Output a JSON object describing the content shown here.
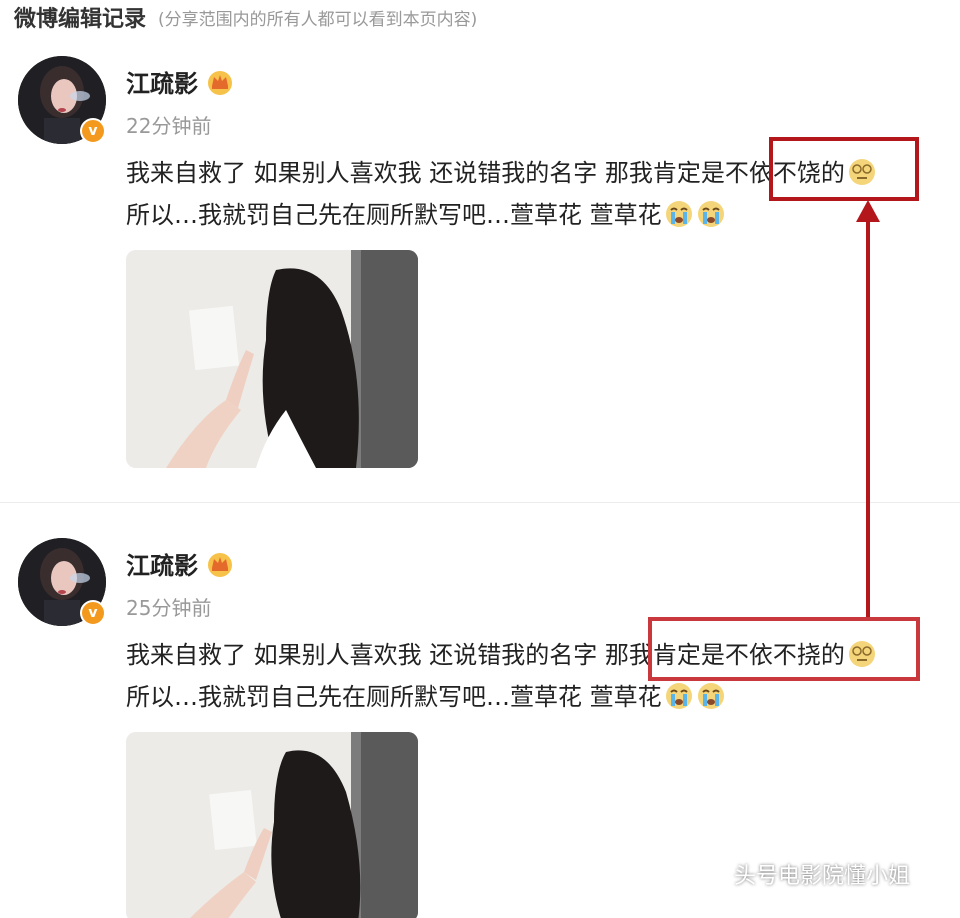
{
  "header": {
    "title": "微博编辑记录",
    "note": "(分享范围内的所有人都可以看到本页内容)"
  },
  "posts": [
    {
      "author": "江疏影",
      "time": "22分钟前",
      "line1": "我来自救了 如果别人喜欢我 还说错我的名字 那我肯定是不依不饶的",
      "line2": "所以…我就罚自己先在厕所默写吧…萱草花 萱草花",
      "highlight": "不依不饶的"
    },
    {
      "author": "江疏影",
      "time": "25分钟前",
      "line1": "我来自救了 如果别人喜欢我 还说错我的名字 那我肯定是不依不挠的",
      "line2": "所以…我就罚自己先在厕所默写吧…萱草花 萱草花",
      "highlight": "那我肯定是不依不挠的"
    }
  ],
  "verified_badge": "v",
  "watermark": "头号电影院懂小姐",
  "colors": {
    "highlight_red": "#b3171c",
    "verified_orange": "#f39a1e"
  },
  "icons": [
    "crown-icon",
    "verified-icon",
    "dizzy-emoji-icon",
    "crying-emoji-icon",
    "wechat-icon"
  ]
}
